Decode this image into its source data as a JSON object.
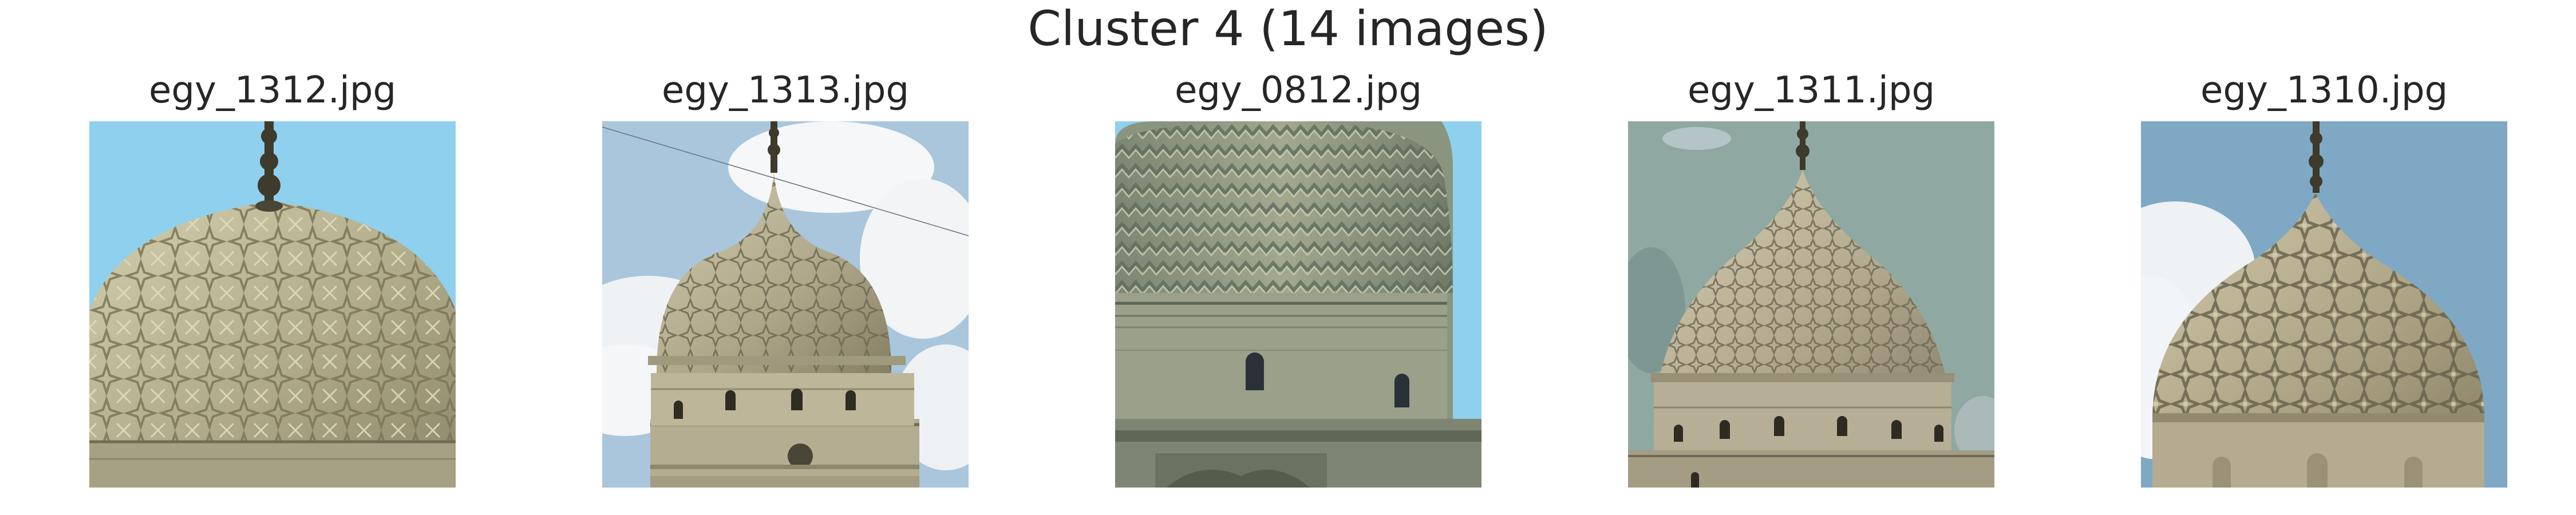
{
  "figure": {
    "title": "Cluster 4 (14 images)"
  },
  "panels": [
    {
      "filename": "egy_1312.jpg",
      "subject": "carved stone mausoleum dome with star-pattern relief, close view against blue sky"
    },
    {
      "filename": "egy_1313.jpg",
      "subject": "stone dome with geometric carving and windowed drum, clouds behind"
    },
    {
      "filename": "egy_0812.jpg",
      "subject": "stone dome with chevron zigzag carving above arched-window drum"
    },
    {
      "filename": "egy_1311.jpg",
      "subject": "stone dome with geometric star carving and windowed drum, teal sky"
    },
    {
      "filename": "egy_1310.jpg",
      "subject": "stone dome with interlacing star carving, cloud at left"
    }
  ],
  "colors": {
    "title_text": "#262626",
    "background": "#ffffff",
    "sky_blue": "#8fd0ee",
    "sky_pale": "#c9dcea",
    "sky_teal": "#8fa8a2",
    "stone_light": "#b7b08f",
    "stone_shadow": "#6f6b55"
  }
}
